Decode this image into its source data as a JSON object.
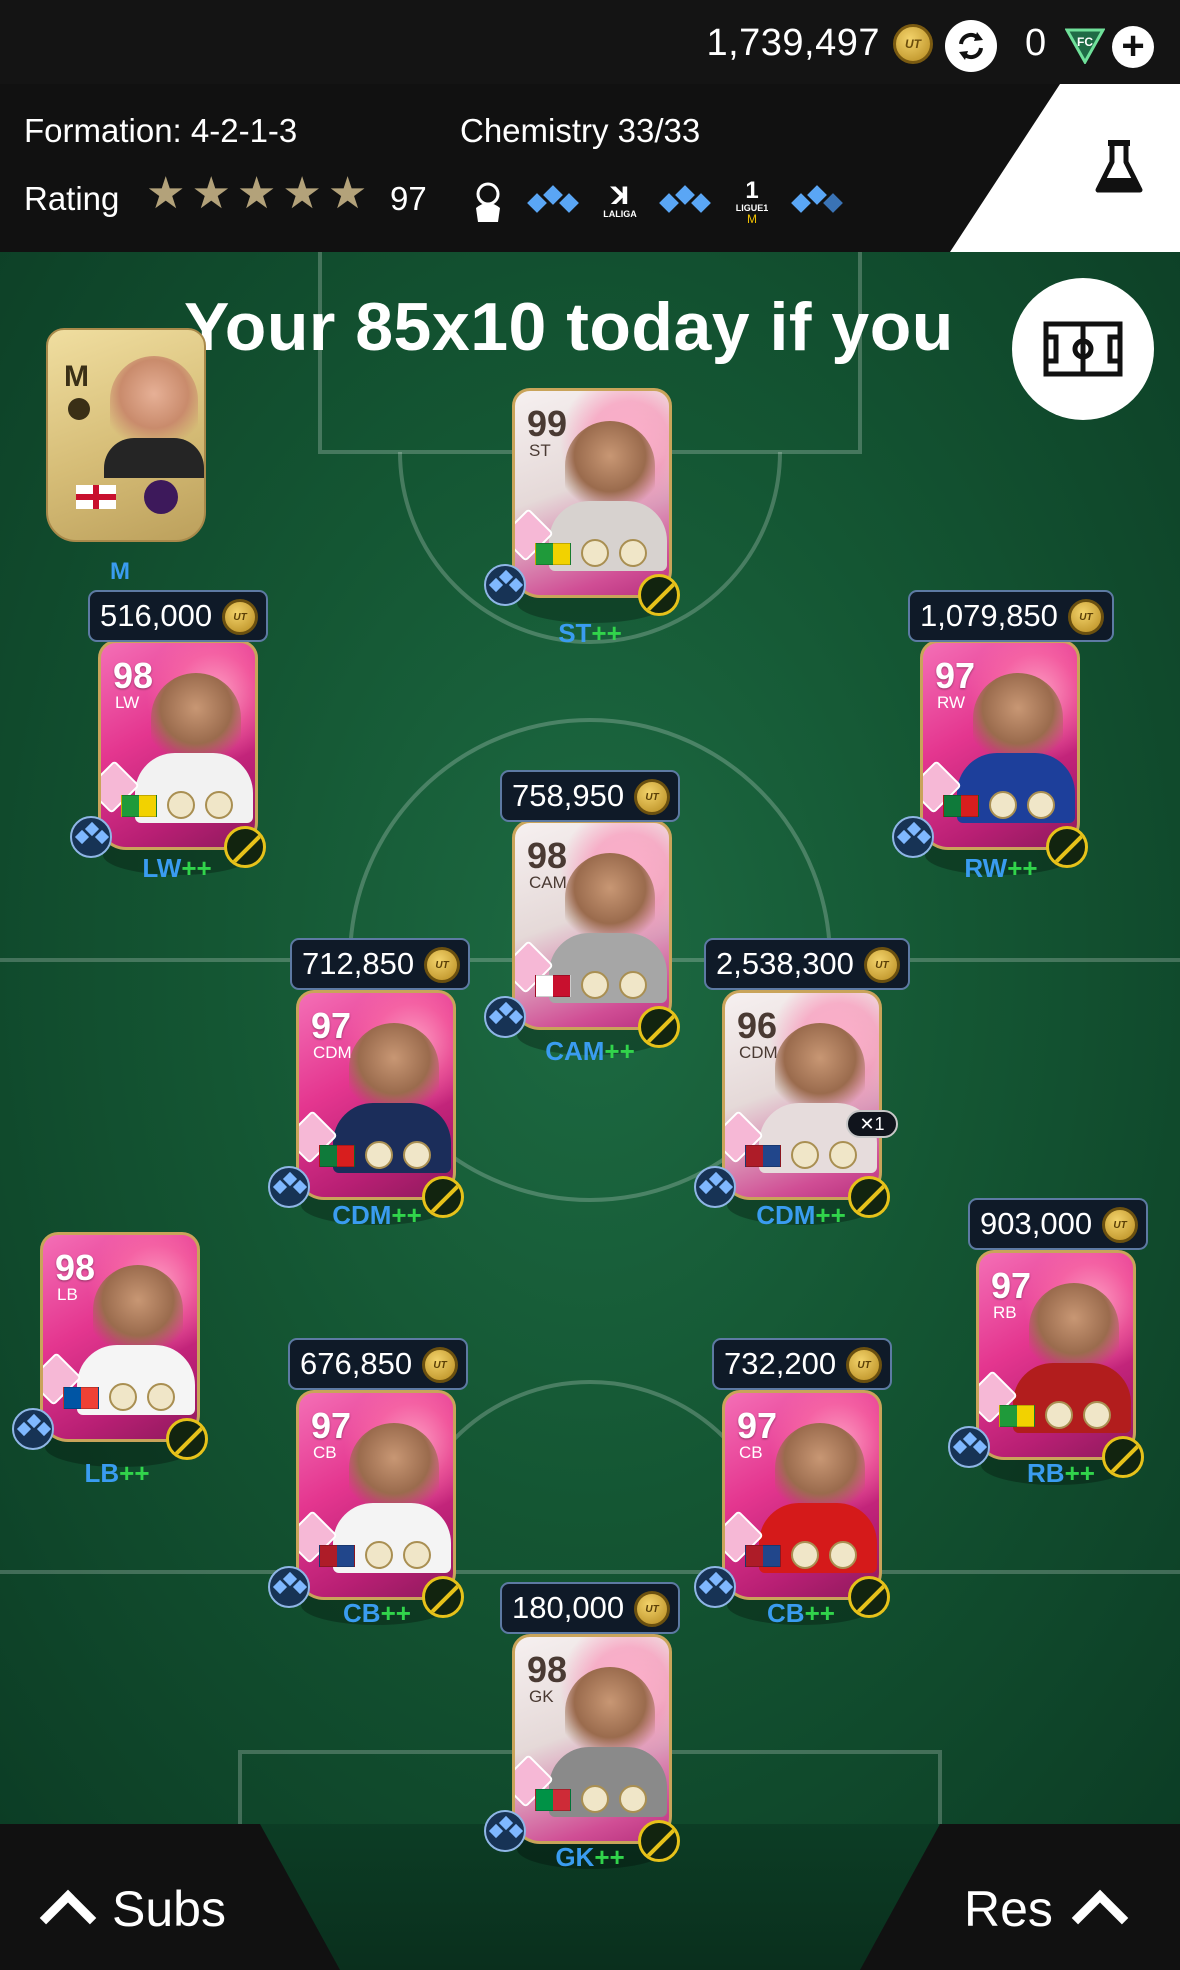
{
  "topbar": {
    "coins": "1,739,497",
    "coin_icon": "ut-coin-icon",
    "points": "0",
    "refresh_icon": "refresh-icon",
    "plus_icon": "plus-icon"
  },
  "squad": {
    "formation": "Formation: 4-2-1-3",
    "chemistry": "Chemistry 33/33",
    "rating_label": "Rating",
    "stars": 5,
    "rating": "97",
    "leagues": [
      "premier-league-logo",
      "laliga-logo",
      "ligue1-logo"
    ],
    "laliga_text": "LALIGA",
    "ligue1_text": "LIGUE1"
  },
  "banner": "Your 85x10 today  if you",
  "manager": {
    "letter": "M",
    "label": "M"
  },
  "players": [
    {
      "id": "st",
      "ovr": "99",
      "pos": "ST",
      "label": "ST",
      "price": null,
      "icon": true
    },
    {
      "id": "lw",
      "ovr": "98",
      "pos": "LW",
      "label": "LW",
      "price": "516,000",
      "icon": false
    },
    {
      "id": "rw",
      "ovr": "97",
      "pos": "RW",
      "label": "RW",
      "price": "1,079,850",
      "icon": false
    },
    {
      "id": "cam",
      "ovr": "98",
      "pos": "CAM",
      "label": "CAM",
      "price": "758,950",
      "icon": true
    },
    {
      "id": "cdm1",
      "ovr": "97",
      "pos": "CDM",
      "label": "CDM",
      "price": "712,850",
      "icon": false
    },
    {
      "id": "cdm2",
      "ovr": "96",
      "pos": "CDM",
      "label": "CDM",
      "price": "2,538,300",
      "icon": true
    },
    {
      "id": "lb",
      "ovr": "98",
      "pos": "LB",
      "label": "LB",
      "price": null,
      "icon": false
    },
    {
      "id": "rb",
      "ovr": "97",
      "pos": "RB",
      "label": "RB",
      "price": "903,000",
      "icon": false
    },
    {
      "id": "cb1",
      "ovr": "97",
      "pos": "CB",
      "label": "CB",
      "price": "676,850",
      "icon": false
    },
    {
      "id": "cb2",
      "ovr": "97",
      "pos": "CB",
      "label": "CB",
      "price": "732,200",
      "icon": false
    },
    {
      "id": "gk",
      "ovr": "98",
      "pos": "GK",
      "label": "GK",
      "price": "180,000",
      "icon": true
    }
  ],
  "plusplus": "++",
  "coin_text": "UT",
  "cdm2_badge": "1",
  "bottom": {
    "subs": "Subs",
    "res": "Res"
  },
  "colors": {
    "pitch": "#145633",
    "position_label": "#3a9cf0",
    "plus": "#31d44b",
    "card_pink": "#e4368f"
  }
}
